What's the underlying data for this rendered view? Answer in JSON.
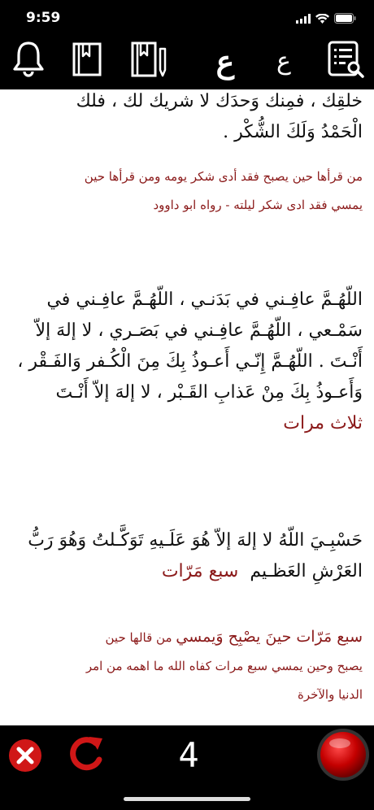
{
  "status_bar": {
    "time": "9:59"
  },
  "toolbar": {
    "bell_icon": "bell-icon",
    "book_icon": "book-icon",
    "book_edit_icon": "book-edit-icon",
    "font_large_label": "ع",
    "font_small_label": "ع",
    "list_search_icon": "list-search-icon"
  },
  "content": {
    "section1": {
      "dua_line1": "خلقِك ، فمِنك وَحدَك لا شريك لك ، فلك",
      "dua_line2": "الْحَمْدُ وَلَكَ الشُّكْر .",
      "note_line1": "من قرأها حين يصبح فقد أدى شكر يومه ومن قرأها حين",
      "note_line2": "يمسي فقد ادى شكر ليلته - رواه ابو داوود"
    },
    "section2": {
      "dua_line1": "اللّهُـمَّ عافِـني في بَدَنـي ، اللّهُـمَّ عافِـني في",
      "dua_line2": "سَمْـعي ، اللّهُـمَّ عافِـني في بَصَـري ، لا إلهَ إلاّ",
      "dua_line3": "أَنْـتَ . اللّهُـمَّ إِنّـي أَعـوذُ بِكَ مِنَ الْكُـفر وَالفَـقْر ،",
      "dua_line4": "وَأَعـوذُ بِكَ مِنْ عَذابِ القَـبْر ، لا إلهَ إلاّ أَنْـتَ",
      "count": "ثلاث مرات"
    },
    "section3": {
      "dua_line1": "حَسْبِـيَ اللّهُ لا إلهَ إلاّ هُوَ عَلَـيهِ تَوَكَّـلتُ وَهُوَ رَبُّ",
      "dua_line2": "العَرْشِ العَظـيم",
      "count_inline": "سبع مَرّات",
      "note_line1_highlight": "سبع مَرّات حينَ يصْبِح وَيمسي",
      "note_line1_rest": "من قالها حين",
      "note_line2": "يصبح وحين يمسي سبع مرات كفاه الله ما اهمه من امر",
      "note_line3": "الدنيا والآخرة"
    }
  },
  "bottom_bar": {
    "close_icon": "close-icon",
    "reset_icon": "reset-icon",
    "counter": "4",
    "tap_button_icon": "red-tap-button"
  },
  "colors": {
    "accent_red": "#8b1a1a",
    "icon_red": "#d01717",
    "background": "#000000"
  }
}
